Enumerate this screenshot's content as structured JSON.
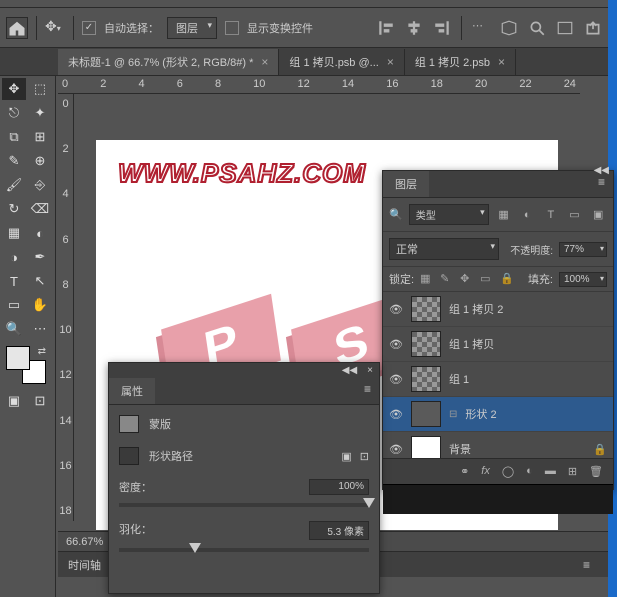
{
  "optionsBar": {
    "autoSelect": "自动选择：",
    "layerDD": "图层",
    "showTransform": "显示变换控件"
  },
  "tabs": [
    {
      "label": "未标题-1 @ 66.7% (形状 2, RGB/8#) *",
      "active": true
    },
    {
      "label": "组 1 拷贝.psb @...",
      "active": false
    },
    {
      "label": "组 1 拷贝 2.psb",
      "active": false
    }
  ],
  "rulerH": [
    "0",
    "2",
    "4",
    "6",
    "8",
    "10",
    "12",
    "14",
    "16",
    "18",
    "20",
    "22",
    "24"
  ],
  "rulerV": [
    "0",
    "2",
    "4",
    "6",
    "8",
    "10",
    "12",
    "14",
    "16",
    "18"
  ],
  "canvas": {
    "watermark": "WWW.PSAHZ.COM",
    "letters": [
      "P",
      "S"
    ]
  },
  "status": {
    "zoom": "66.67%"
  },
  "timeline": {
    "label": "时间轴"
  },
  "layersPanel": {
    "tab": "图层",
    "filter": {
      "kind": "类型"
    },
    "blend": {
      "mode": "正常",
      "opacityLabel": "不透明度:",
      "opacity": "77%"
    },
    "lock": {
      "label": "锁定:",
      "fillLabel": "填充:",
      "fill": "100%"
    },
    "items": [
      {
        "name": "组 1 拷贝 2",
        "thumb": "checker"
      },
      {
        "name": "组 1 拷贝",
        "thumb": "checker"
      },
      {
        "name": "组 1",
        "thumb": "checker"
      },
      {
        "name": "形状 2",
        "thumb": "shape",
        "selected": true,
        "mask": true
      },
      {
        "name": "背景",
        "thumb": "white",
        "locked": true
      }
    ]
  },
  "propsPanel": {
    "tab": "属性",
    "mask": "蒙版",
    "shapePath": "形状路径",
    "density": {
      "label": "密度：",
      "value": "100%",
      "pos": 100
    },
    "feather": {
      "label": "羽化：",
      "value": "5.3 像素",
      "pos": 28
    }
  }
}
